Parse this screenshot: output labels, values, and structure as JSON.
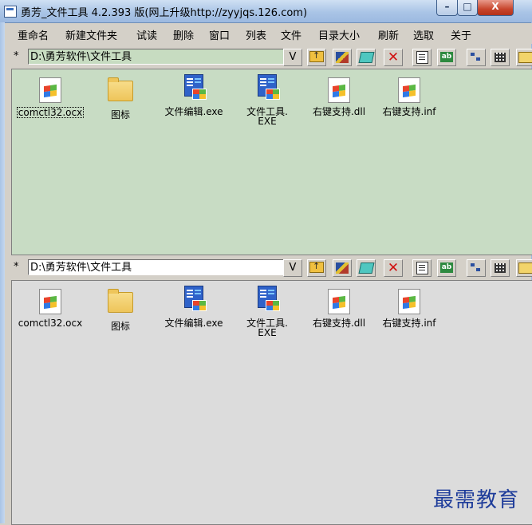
{
  "window": {
    "title": "勇芳_文件工具   4.2.393 版(网上升级http://zyyjqs.126.com)",
    "minimize_label": "–",
    "maximize_label": "□",
    "close_label": "X"
  },
  "menu": [
    "重命名",
    "新建文件夹",
    "试读",
    "删除",
    "窗口",
    "列表",
    "文件",
    "目录大小",
    "刷新",
    "选取",
    "关于"
  ],
  "top_pane": {
    "marker": "*",
    "path": "D:\\勇芳软件\\文件工具",
    "v_label": "V",
    "files": [
      {
        "name": "comctl32.ocx",
        "icon": "ocx-file-icon"
      },
      {
        "name": "图标",
        "icon": "folder-icon"
      },
      {
        "name": "文件编辑.exe",
        "icon": "exe-app-icon"
      },
      {
        "name": "文件工具.\nEXE",
        "icon": "exe-app-icon"
      },
      {
        "name": "右键支持.dll",
        "icon": "dll-file-icon"
      },
      {
        "name": "右键支持.inf",
        "icon": "inf-file-icon"
      }
    ]
  },
  "bottom_pane": {
    "marker": "*",
    "path": "D:\\勇芳软件\\文件工具",
    "v_label": "V",
    "files": [
      {
        "name": "comctl32.ocx",
        "icon": "ocx-file-icon"
      },
      {
        "name": "图标",
        "icon": "folder-icon"
      },
      {
        "name": "文件编辑.exe",
        "icon": "exe-app-icon"
      },
      {
        "name": "文件工具.\nEXE",
        "icon": "exe-app-icon"
      },
      {
        "name": "右键支持.dll",
        "icon": "dll-file-icon"
      },
      {
        "name": "右键支持.inf",
        "icon": "inf-file-icon"
      }
    ]
  },
  "watermark": "最需教育"
}
